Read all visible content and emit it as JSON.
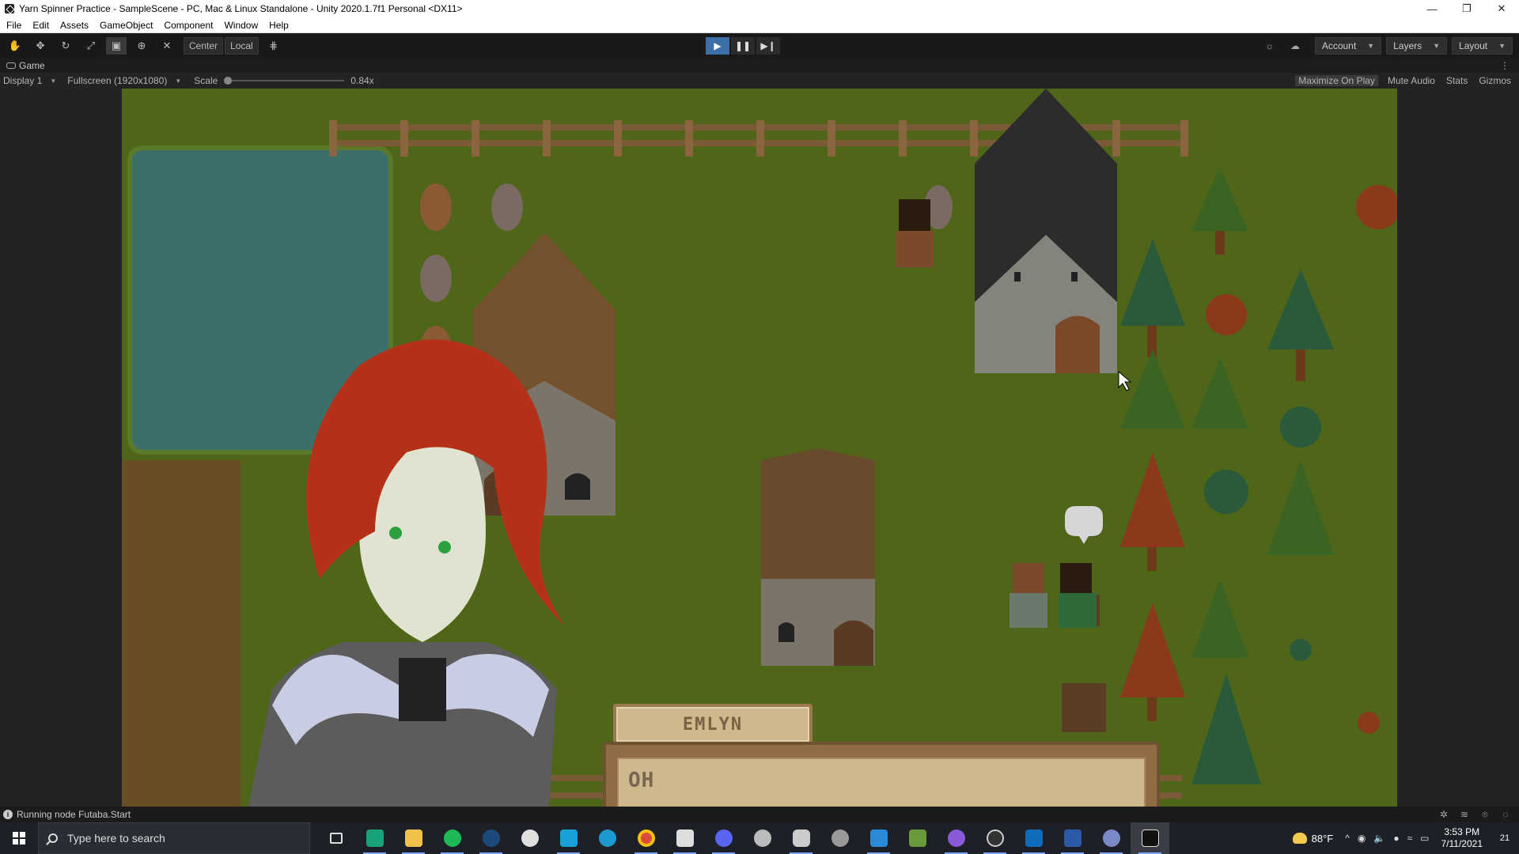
{
  "window": {
    "title": "Yarn Spinner Practice - SampleScene - PC, Mac & Linux Standalone - Unity 2020.1.7f1 Personal <DX11>",
    "controls": [
      "—",
      "❐",
      "✕"
    ]
  },
  "menu": [
    "File",
    "Edit",
    "Assets",
    "GameObject",
    "Component",
    "Window",
    "Help"
  ],
  "toolbar": {
    "pivot_label": "Center",
    "space_label": "Local",
    "account_label": "Account",
    "layers_label": "Layers",
    "layout_label": "Layout"
  },
  "game_tab": {
    "label": "Game"
  },
  "game_toolbar": {
    "display": "Display 1",
    "resolution": "Fullscreen (1920x1080)",
    "scale_label": "Scale",
    "scale_value": "0.84x",
    "maximize": "Maximize On Play",
    "mute": "Mute Audio",
    "stats": "Stats",
    "gizmos": "Gizmos"
  },
  "dialogue": {
    "speaker": "EMLYN",
    "line": "OH",
    "bubble": "•••"
  },
  "status": {
    "message": "Running node Futaba.Start"
  },
  "taskbar": {
    "search_placeholder": "Type here to search",
    "temperature": "88°F",
    "time": "3:53 PM",
    "date": "7/11/2021",
    "notifications": "21"
  },
  "colors": {
    "grass": "#4e6418",
    "play_active": "#3d6ea8",
    "dialogue_panel": "#cdb98c",
    "dialogue_border": "#8f6c44"
  }
}
